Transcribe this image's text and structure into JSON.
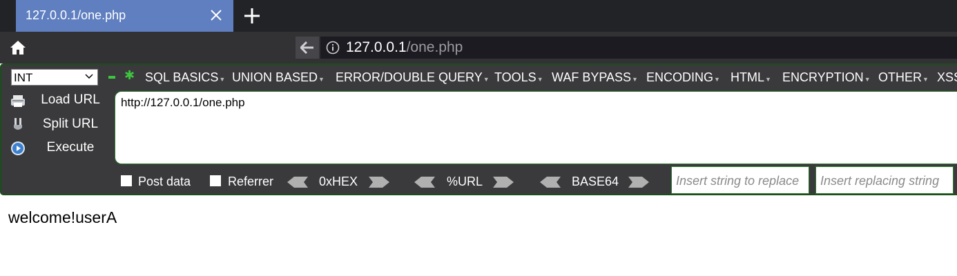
{
  "tab": {
    "title": "127.0.0.1/one.php"
  },
  "nav": {
    "url_host": "127.0.0.1",
    "url_path": "/one.php"
  },
  "hackbar": {
    "select_value": "INT",
    "menu": [
      "SQL BASICS",
      "UNION BASED",
      "ERROR/DOUBLE QUERY",
      "TOOLS",
      "WAF BYPASS",
      "ENCODING",
      "HTML",
      "ENCRYPTION",
      "OTHER",
      "XSS"
    ],
    "buttons": {
      "load_url": "Load URL",
      "split_url": "Split URL",
      "execute": "Execute"
    },
    "url_value": "http://127.0.0.1/one.php",
    "post_data_label": "Post data",
    "referrer_label": "Referrer",
    "hex_label": "0xHEX",
    "url_enc_label": "%URL",
    "base64_label": "BASE64",
    "replace_placeholder": "Insert string to replace",
    "replacing_placeholder": "Insert replacing string"
  },
  "page": {
    "text": "welcome!userA"
  }
}
